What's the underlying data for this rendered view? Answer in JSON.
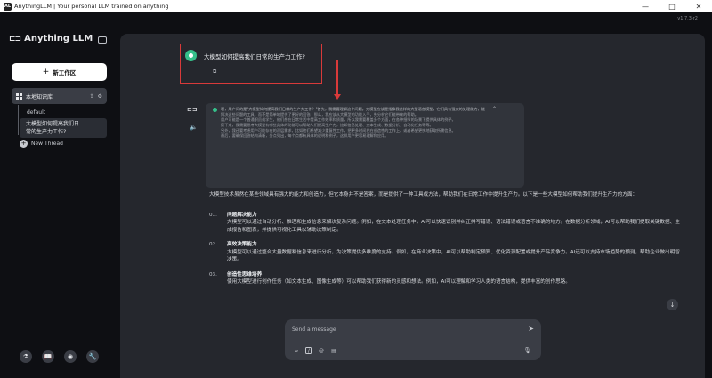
{
  "window": {
    "app_icon": "AL",
    "title": "AnythingLLM | Your personal LLM trained on anything",
    "minimize": "—",
    "maximize": "□",
    "close": "✕",
    "version": "v1.7.3-r2"
  },
  "sidebar": {
    "brand_mark": "⊏⊐",
    "brand": "Anything LLM",
    "new_workspace_label": "新工作区",
    "workspace_label": "本地知识库",
    "threads": {
      "default": "default",
      "active_line1": "大模型如何提高我们日",
      "active_line2": "常的生产力工作?",
      "new_thread": "New Thread"
    }
  },
  "chat": {
    "user_message": "大模型如何提高我们日常的生产力工作?",
    "thinking": {
      "header": "嗯，用户问的是\"大模型如何提高我们日常的生产力工作？\"首先，我需要理解这个问题。大模型应该是指像我这样的大型语言模型，它们具有强大的处理能力，能",
      "lines": [
        "解决这些问题的工具，而不是简单地提供了更好的回答。那么，我应该从大模型的功能入手，先分析它们能带来的帮助。",
        "用户可能是一个普通职员或学生，他们想在日常生活中提高工作效率和质量，所以我需要覆盖多个方面，在各种细节的场景下提供具体的例子。",
        "接下来，我需要思考大模型有哪些具体的功能可以帮助人们提高生产力，比如信息处理、文本生成、数据分析、自动化任务等等。",
        "另外，我还要考虑用户可能存在的深层需求，比如他们希望减少重复性工作，把更多时间花在创造性的工作上，或者希望更快地获取所需信息。",
        "最后，要确保回答结构清晰，分点列出，每个点都有具体的说明和例子，这样用户更容易理解和应用。"
      ]
    },
    "answer": {
      "intro": "大模型技术虽然在某些领域具有强大的能力和创造力，但它本身并不是答案，而是提供了一种工具或方法，帮助我们在日常工作中提升生产力。以下是一些大模型如何帮助我们提升生产力的方面：",
      "items": [
        {
          "num": "01.",
          "title": "问题解决能力",
          "text": "大模型可以通过自动分析、推理和生成信息来解决复杂问题。例如，在文本处理任务中，AI可以快速识别并纠正拼写错误、语法错误或语言不准确的地方。在数据分析领域，AI可以帮助我们提取关键数据、生成报告和图表，并提供可视化工具以辅助决策制定。"
        },
        {
          "num": "02.",
          "title": "高效决策能力",
          "text": "大模型可以通过整合大量数据和信息来进行分析，为决策提供多维度的支持。例如，在商业决策中，AI可以帮助制定预算、优化资源配置或提升产品竞争力。AI还可以支持市场趋势的预测，帮助企业做出明智决策。"
        },
        {
          "num": "03.",
          "title": "创造性思维培养",
          "text": "使用大模型进行创作任务（如文本生成、图像生成等）可以帮助我们获得新的灵感和想法。例如，AI可以理解和学习人类的语言结构，提供丰富的创作思路。"
        }
      ]
    }
  },
  "composer": {
    "placeholder": "Send a message"
  },
  "icons": {
    "plus": "+",
    "upload": "⇪",
    "gear": "⚙",
    "copy": "⧉",
    "bot": "⊏⊐",
    "speaker": "🔈",
    "chevron_up": "⌃",
    "arrow_down": "↓",
    "send": "➤",
    "paperclip": "⌀",
    "slash": "/",
    "at": "@",
    "doc": "▤",
    "mic": "🎙",
    "footer": [
      "⚗",
      "📖",
      "◉",
      "🔧"
    ]
  }
}
